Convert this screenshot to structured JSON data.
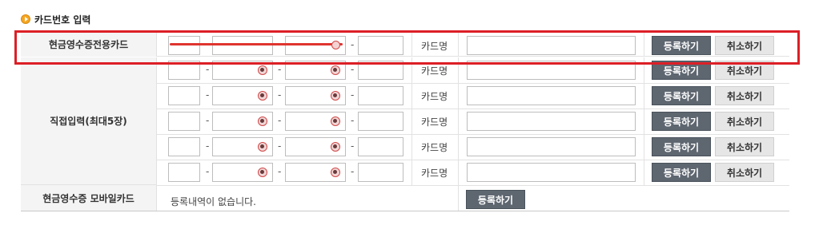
{
  "section": {
    "title": "카드번호 입력"
  },
  "rows": {
    "dedicated_label": "현금영수증전용카드",
    "direct_label": "직접입력(최대5장)",
    "mobile_label": "현금영수증 모바일카드"
  },
  "card_name_label": "카드명",
  "dash": "-",
  "buttons": {
    "register": "등록하기",
    "cancel": "취소하기"
  },
  "mobile": {
    "empty_text": "등록내역이 없습니다."
  },
  "colors": {
    "highlight_border": "#dc1f26",
    "dark_button": "#5e6670",
    "bullet": "#f5a623"
  }
}
